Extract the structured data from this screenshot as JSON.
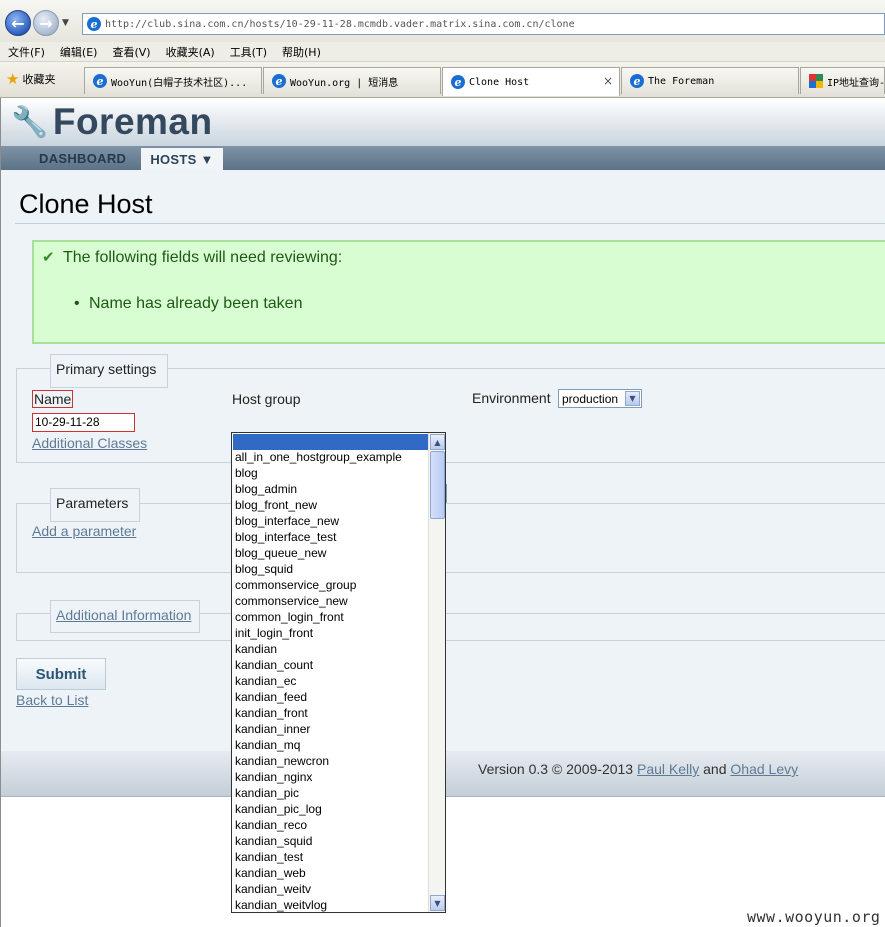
{
  "browser": {
    "address": "http://club.sina.com.cn/hosts/10-29-11-28.mcmdb.vader.matrix.sina.com.cn/clone",
    "menu": [
      "文件(F)",
      "编辑(E)",
      "查看(V)",
      "收藏夹(A)",
      "工具(T)",
      "帮助(H)"
    ],
    "favorites_label": "收藏夹",
    "tabs": [
      {
        "label": "WooYun(白帽子技术社区)..."
      },
      {
        "label": "WooYun.org | 短消息"
      },
      {
        "label": "Clone Host"
      },
      {
        "label": "The Foreman"
      },
      {
        "label": "IP地址查询-"
      }
    ],
    "tab_close": "×"
  },
  "app": {
    "logo": "Foreman",
    "nav": {
      "dashboard": "DASHBOARD",
      "hosts": "HOSTS ▼"
    }
  },
  "page": {
    "title": "Clone Host",
    "alert": {
      "heading": "The following fields will need reviewing:",
      "message": "Name has already been taken"
    },
    "primary": {
      "legend": "Primary settings",
      "name_label": "Name",
      "name_value": "10-29-11-28",
      "additional_classes": "Additional Classes",
      "hostgroup_label": "Host group",
      "environment_label": "Environment",
      "environment_value": "production"
    },
    "parameters": {
      "legend": "Parameters",
      "add_link": "Add a parameter"
    },
    "additional_info": {
      "legend": "Additional Information"
    },
    "submit": "Submit",
    "back": "Back to List"
  },
  "footer": {
    "prefix": "Version 0.3 © 2009-2013",
    "author1": "Paul Kelly",
    "and": "and",
    "author2": "Ohad Levy"
  },
  "hostgroup_options": [
    "all_in_one_hostgroup_example",
    "blog",
    "blog_admin",
    "blog_front_new",
    "blog_interface_new",
    "blog_interface_test",
    "blog_queue_new",
    "blog_squid",
    "commonservice_group",
    "commonservice_new",
    "common_login_front",
    "init_login_front",
    "kandian",
    "kandian_count",
    "kandian_ec",
    "kandian_feed",
    "kandian_front",
    "kandian_inner",
    "kandian_mq",
    "kandian_newcron",
    "kandian_nginx",
    "kandian_pic",
    "kandian_pic_log",
    "kandian_reco",
    "kandian_squid",
    "kandian_test",
    "kandian_web",
    "kandian_weitv",
    "kandian_weitvlog"
  ],
  "watermark": "www.wooyun.org"
}
